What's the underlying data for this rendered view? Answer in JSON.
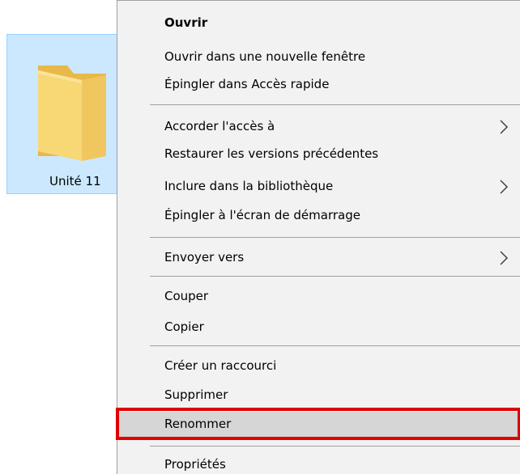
{
  "folder": {
    "label": "Unité 11",
    "icon": "folder-icon",
    "selected": true,
    "colors": {
      "tile_background": "#cce8ff",
      "tile_border": "#99d1ff",
      "folder_fill": "#f8d775"
    }
  },
  "context_menu": {
    "colors": {
      "background": "#f2f2f2",
      "separator": "#a0a0a0",
      "hover": "#d6d6d6",
      "highlight_border": "#e00000"
    },
    "items": [
      {
        "label": "Ouvrir",
        "default": true,
        "submenu": false
      },
      {
        "label": "Ouvrir dans une nouvelle fenêtre",
        "submenu": false
      },
      {
        "label": "Épingler dans Accès rapide",
        "submenu": false
      },
      {
        "label": "Accorder l'accès à",
        "submenu": true
      },
      {
        "label": "Restaurer les versions précédentes",
        "submenu": false
      },
      {
        "label": "Inclure dans la bibliothèque",
        "submenu": true
      },
      {
        "label": "Épingler à l'écran de démarrage",
        "submenu": false
      },
      {
        "label": "Envoyer vers",
        "submenu": true
      },
      {
        "label": "Couper",
        "submenu": false
      },
      {
        "label": "Copier",
        "submenu": false
      },
      {
        "label": "Créer un raccourci",
        "submenu": false
      },
      {
        "label": "Supprimer",
        "submenu": false
      },
      {
        "label": "Renommer",
        "submenu": false,
        "hovered": true,
        "highlighted": true
      },
      {
        "label": "Propriétés",
        "submenu": false
      }
    ]
  }
}
